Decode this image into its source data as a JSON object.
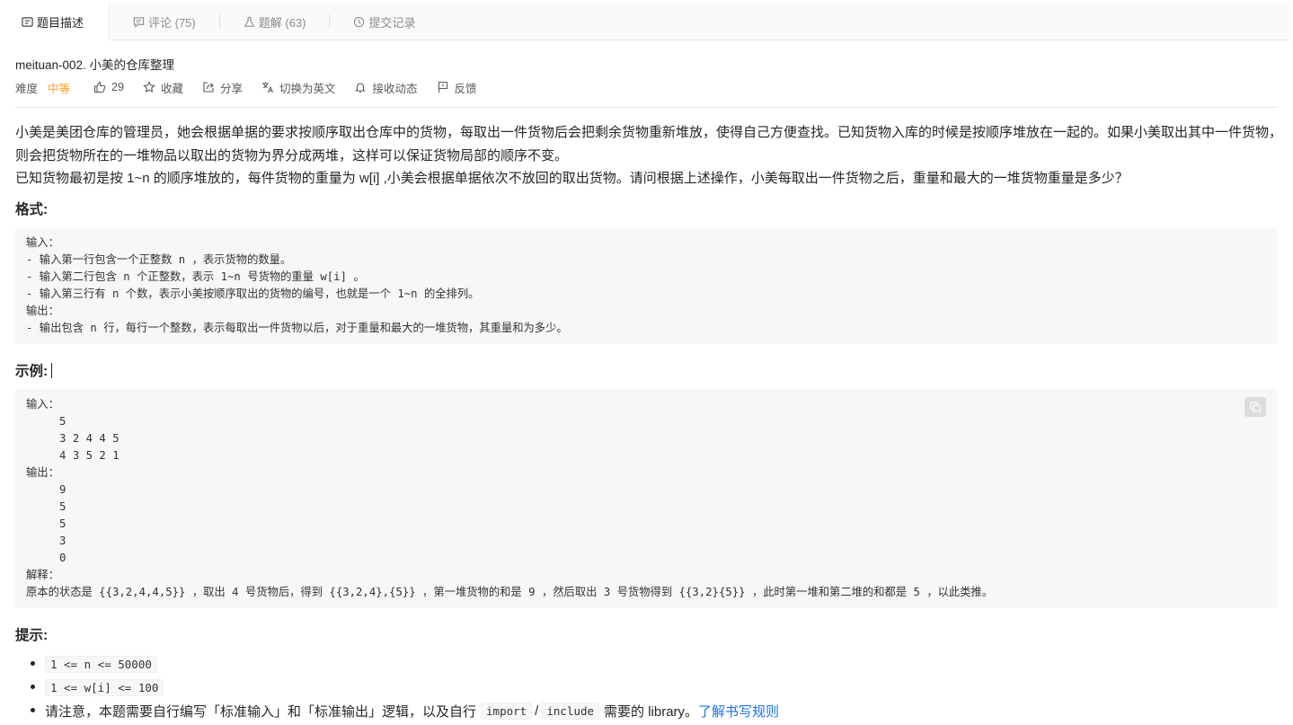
{
  "tabs": [
    {
      "label": "题目描述",
      "icon": "description-icon",
      "active": true
    },
    {
      "label": "评论 (75)",
      "icon": "comment-icon",
      "active": false
    },
    {
      "label": "题解 (63)",
      "icon": "flask-icon",
      "active": false
    },
    {
      "label": "提交记录",
      "icon": "clock-icon",
      "active": false
    }
  ],
  "problem": {
    "title": "meituan-002. 小美的仓库整理",
    "difficulty_label": "难度",
    "difficulty": "中等",
    "likes": "29",
    "favorite": "收藏",
    "share": "分享",
    "switch_lang": "切换为英文",
    "notify": "接收动态",
    "feedback": "反馈"
  },
  "description": {
    "p1": "小美是美团仓库的管理员，她会根据单据的要求按顺序取出仓库中的货物，每取出一件货物后会把剩余货物重新堆放，使得自己方便查找。已知货物入库的时候是按顺序堆放在一起的。如果小美取出其中一件货物，则会把货物所在的一堆物品以取出的货物为界分成两堆，这样可以保证货物局部的顺序不变。",
    "p2": "已知货物最初是按 1~n 的顺序堆放的，每件货物的重量为 w[i] ,小美会根据单据依次不放回的取出货物。请问根据上述操作，小美每取出一件货物之后，重量和最大的一堆货物重量是多少？"
  },
  "format": {
    "heading": "格式:",
    "code": "输入：\n- 输入第一行包含一个正整数 n ，表示货物的数量。\n- 输入第二行包含 n 个正整数，表示 1~n 号货物的重量 w[i] 。\n- 输入第三行有 n 个数，表示小美按顺序取出的货物的编号，也就是一个 1~n 的全排列。\n输出：\n- 输出包含 n 行，每行一个整数，表示每取出一件货物以后，对于重量和最大的一堆货物，其重量和为多少。"
  },
  "example": {
    "heading": "示例:",
    "code": "输入：\n     5\n     3 2 4 4 5\n     4 3 5 2 1\n输出：\n     9\n     5\n     5\n     3\n     0\n解释：\n原本的状态是 {{3,2,4,4,5}} ，取出 4 号货物后，得到 {{3,2,4},{5}} ，第一堆货物的和是 9 ，然后取出 3 号货物得到 {{3,2}{5}} ，此时第一堆和第二堆的和都是 5 ，以此类推。"
  },
  "tips": {
    "heading": "提示:",
    "c1": "1 <= n <= 50000",
    "c2": "1 <= w[i] <= 100",
    "note_pre": "请注意，本题需要自行编写「标准输入」和「标准输出」逻辑，以及自行",
    "code_import": "import",
    "slash": "/",
    "code_include": "include",
    "note_post": "需要的 library。",
    "link": "了解书写规则"
  }
}
